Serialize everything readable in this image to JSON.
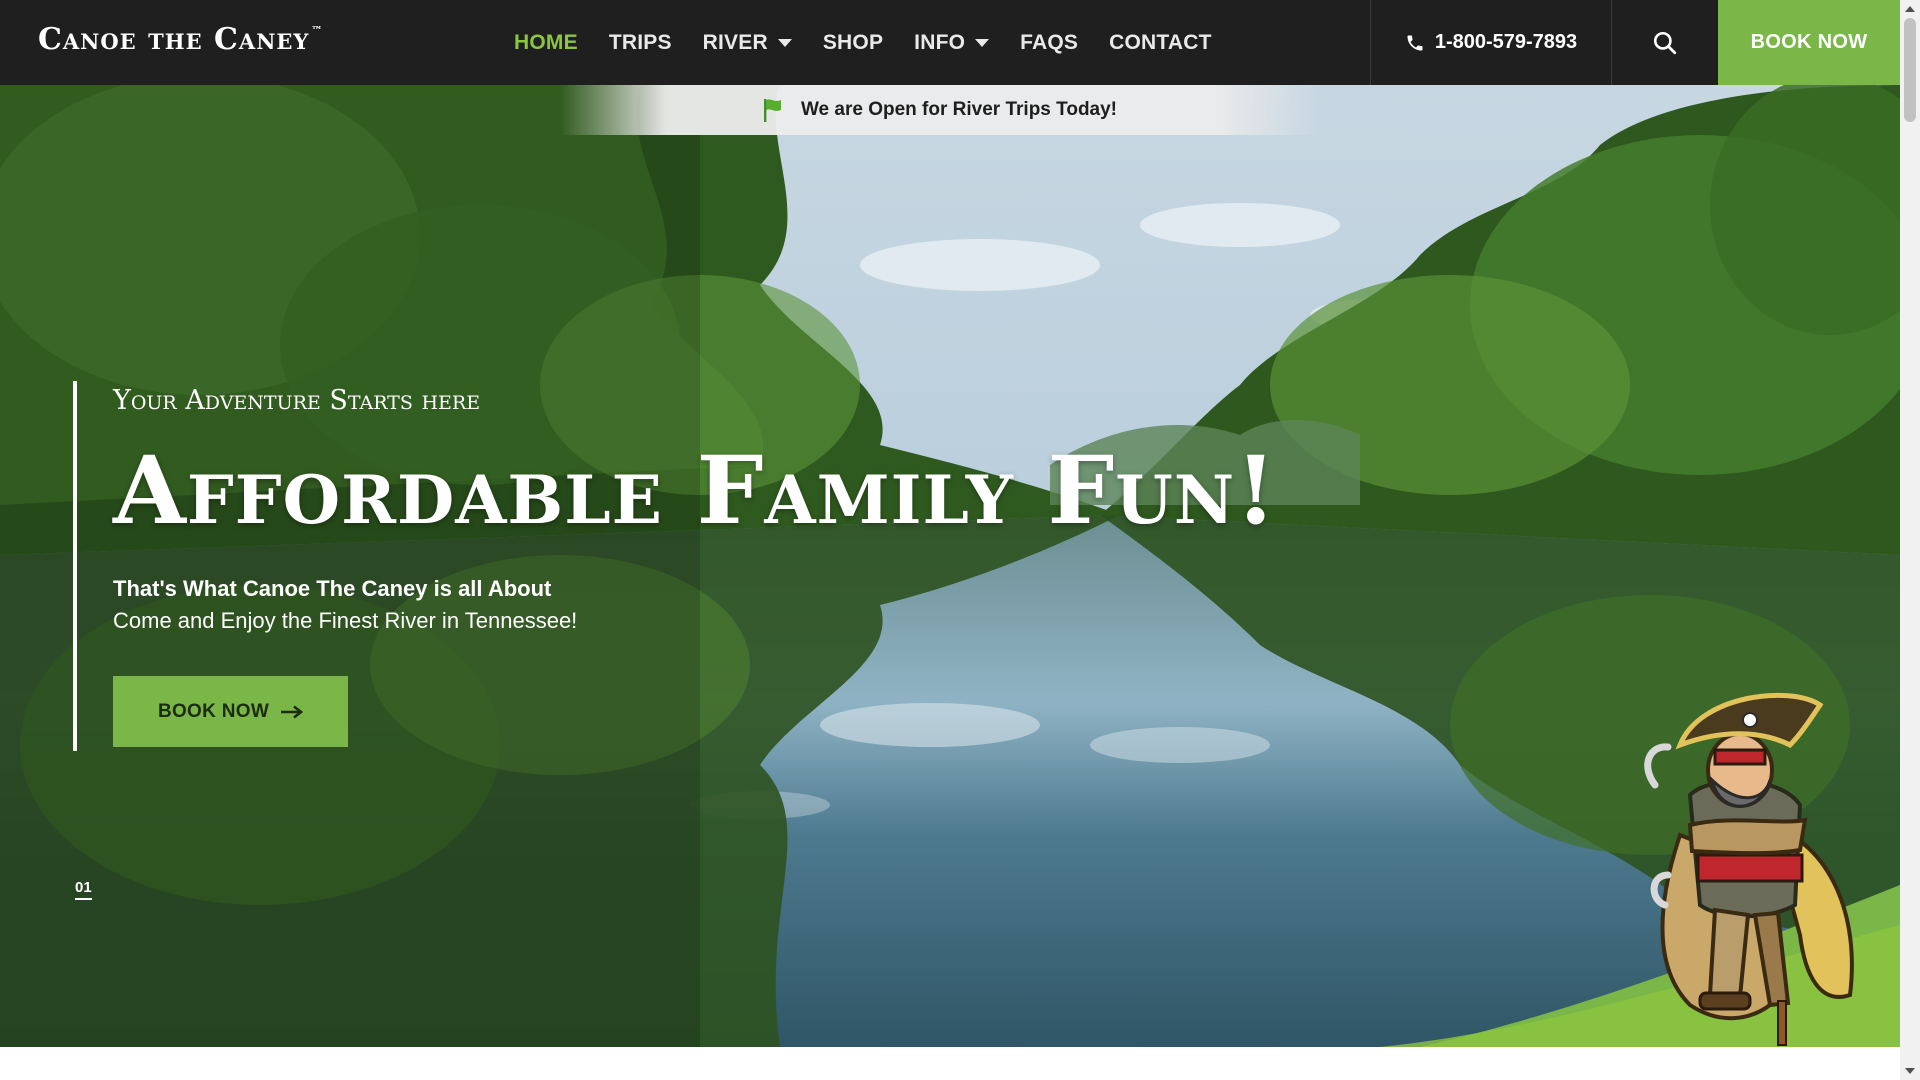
{
  "brand": {
    "logo_text": "Canoe the Caney",
    "trademark": "™"
  },
  "nav": {
    "items": [
      {
        "label": "HOME",
        "active": true,
        "dropdown": false
      },
      {
        "label": "TRIPS",
        "active": false,
        "dropdown": false
      },
      {
        "label": "RIVER",
        "active": false,
        "dropdown": true
      },
      {
        "label": "SHOP",
        "active": false,
        "dropdown": false
      },
      {
        "label": "INFO",
        "active": false,
        "dropdown": true
      },
      {
        "label": "FAQS",
        "active": false,
        "dropdown": false
      },
      {
        "label": "CONTACT",
        "active": false,
        "dropdown": false
      }
    ],
    "phone": "1-800-579-7893",
    "phone_icon": "phone-icon",
    "search_icon": "search-icon",
    "book_label": "BOOK NOW"
  },
  "status": {
    "icon": "flag-icon",
    "text": "We are Open for River Trips Today!"
  },
  "hero": {
    "eyebrow": "Your Adventure Starts here",
    "headline": "Affordable Family Fun!",
    "subtitle_bold": "That's What Canoe The Caney is all About",
    "subtitle": "Come and Enjoy the Finest River in Tennessee!",
    "cta_label": "BOOK NOW",
    "cta_icon": "arrow-right-icon",
    "slide_number": "01"
  },
  "colors": {
    "nav_bg": "#1f1f1f",
    "accent_green": "#7ab648",
    "active_nav": "#8cc63f",
    "text_light": "#ffffff"
  }
}
